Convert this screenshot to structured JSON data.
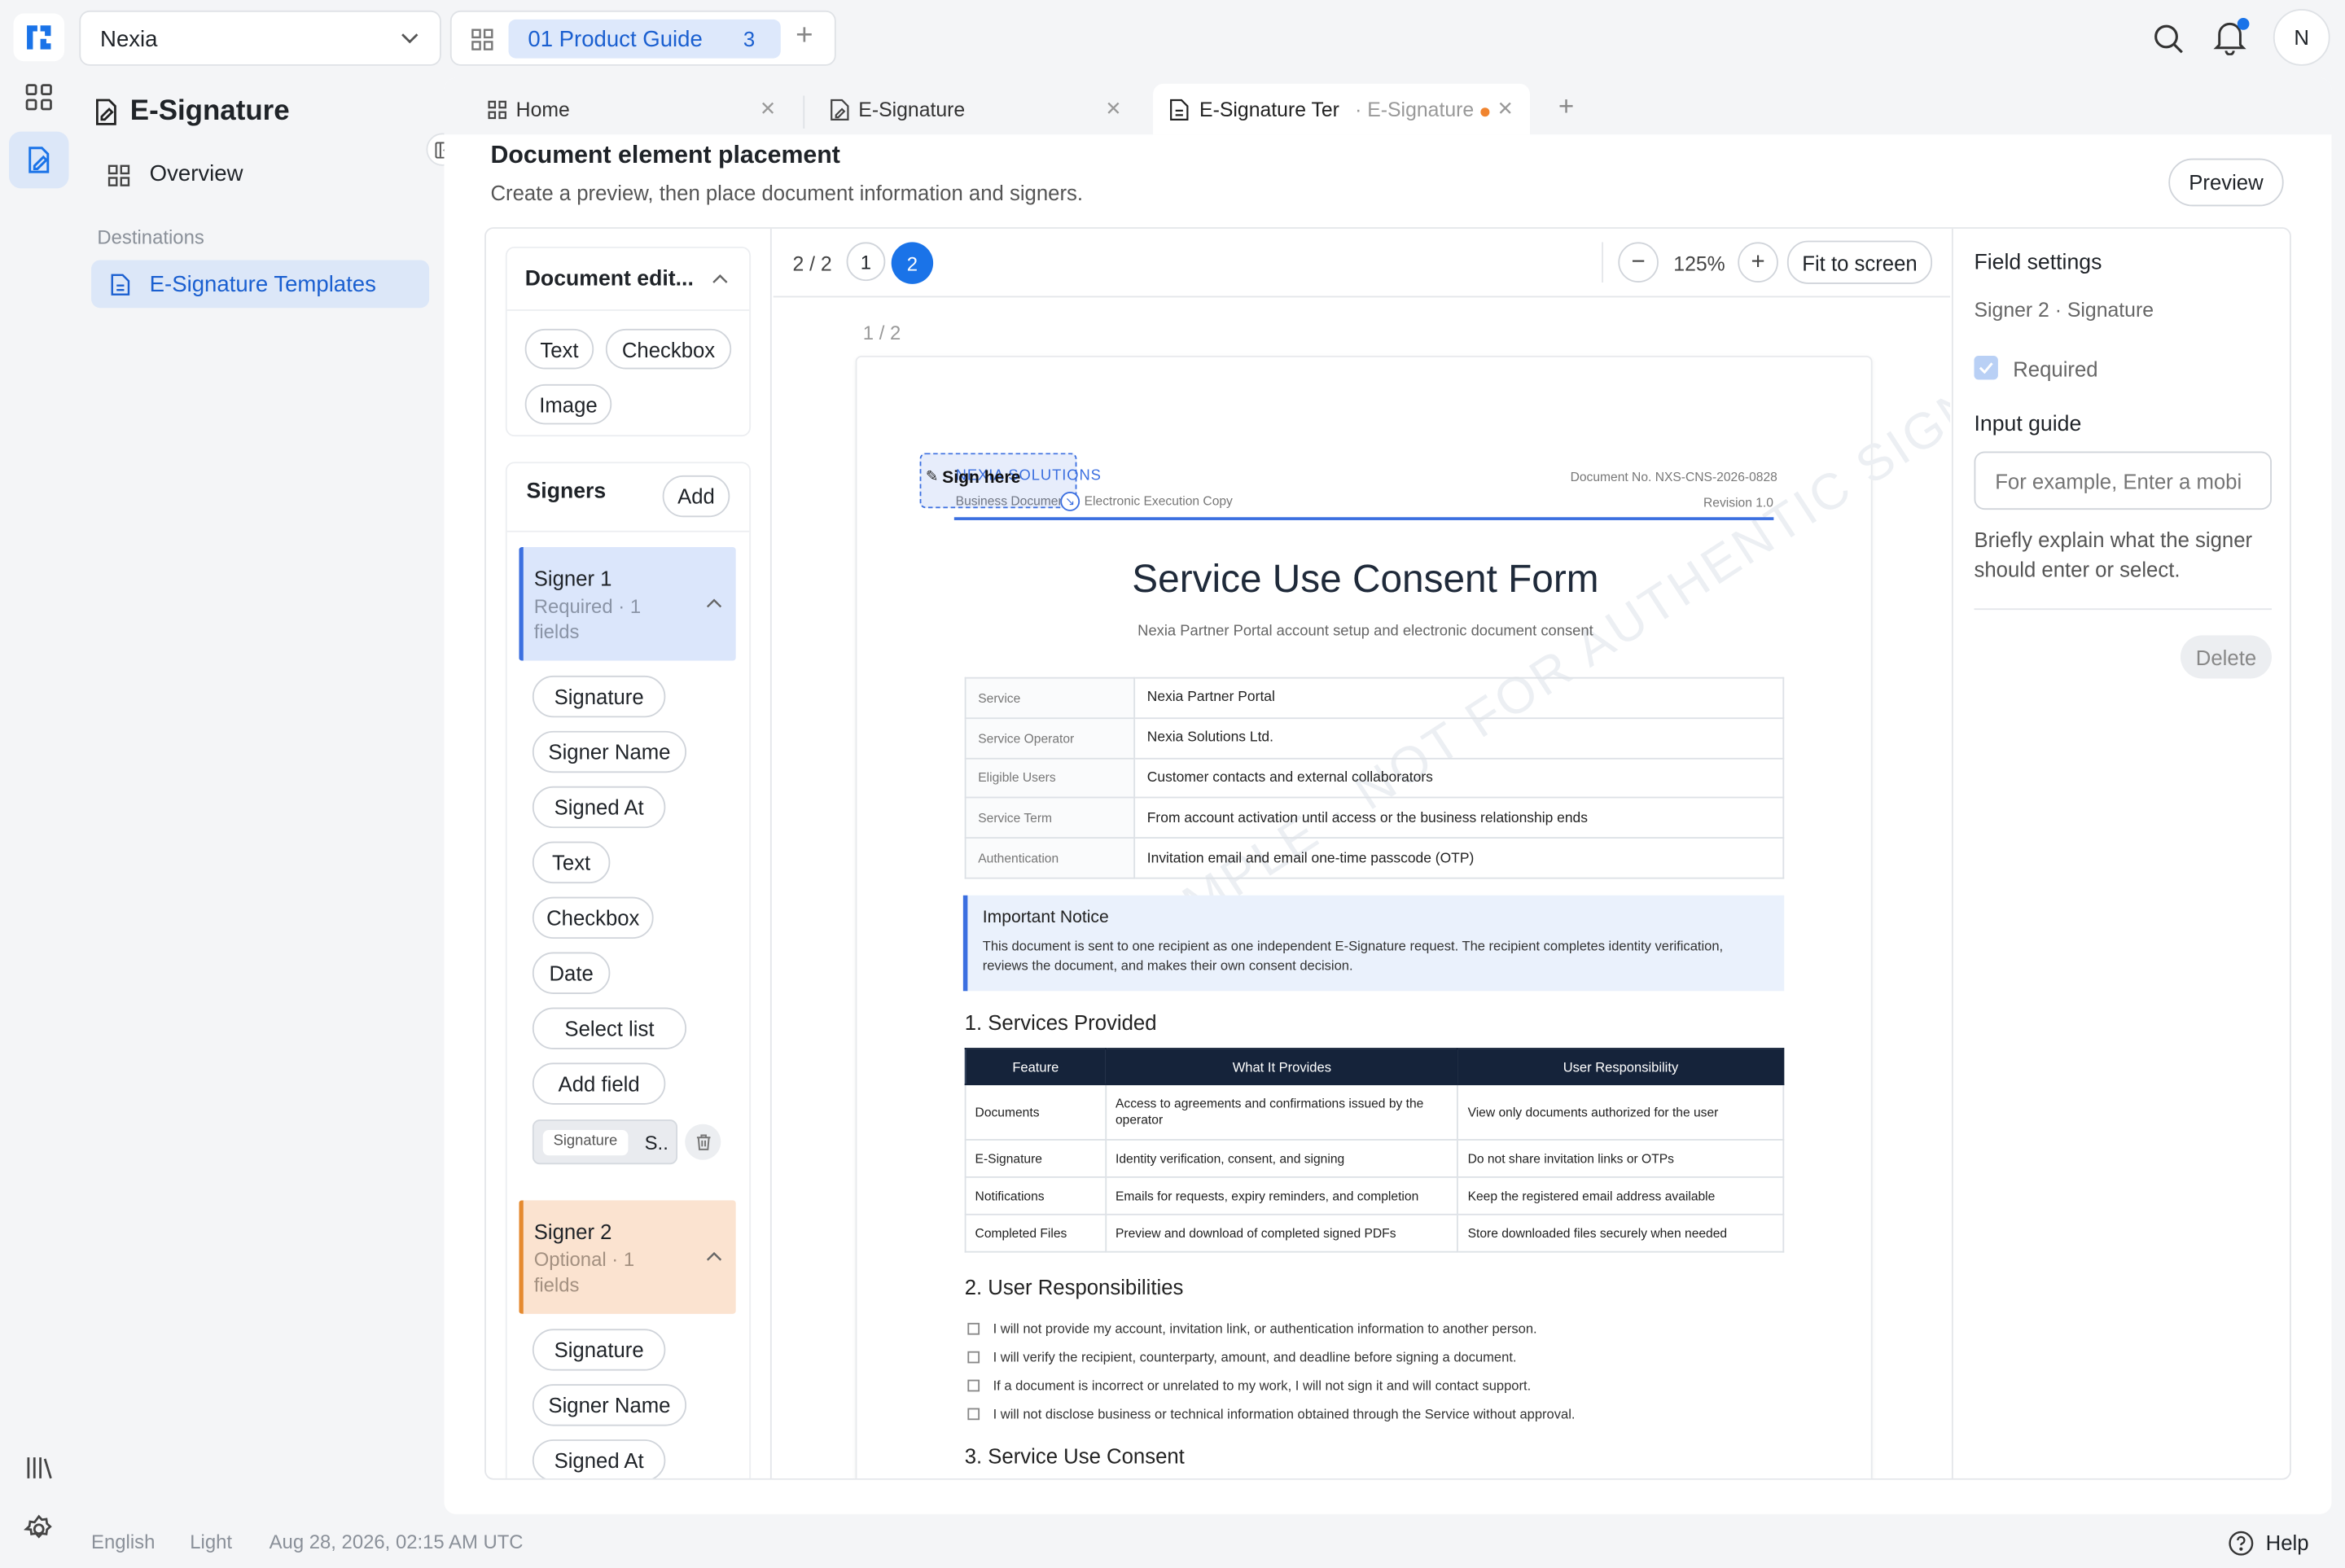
{
  "workspace": {
    "name": "Nexia"
  },
  "project_tab": {
    "label": "01 Product Guide",
    "count": "3"
  },
  "user": {
    "initial": "N"
  },
  "sidebar": {
    "title": "E-Signature",
    "overview": "Overview",
    "section": "Destinations",
    "active_item": "E-Signature Templates"
  },
  "footer": {
    "language": "English",
    "theme": "Light",
    "timestamp": "Aug 28, 2026, 02:15 AM UTC",
    "help": "Help"
  },
  "tabs": [
    {
      "label": "Home"
    },
    {
      "label": "E-Signature"
    },
    {
      "label": "E-Signature Ter",
      "sub": "· E-Signature"
    }
  ],
  "page": {
    "title": "Document element placement",
    "subtitle": "Create a preview, then place document information and signers.",
    "preview_button": "Preview"
  },
  "left_panel": {
    "doc_edit_title": "Document edit...",
    "doc_chips": [
      "Text",
      "Checkbox",
      "Image"
    ],
    "signers_title": "Signers",
    "add_button": "Add",
    "signer1": {
      "name": "Signer 1",
      "meta": "Required · 1 fields"
    },
    "signer1_fields": [
      "Signature",
      "Signer Name",
      "Signed At",
      "Text",
      "Checkbox",
      "Date",
      "Select list",
      "Add field"
    ],
    "placed_field": {
      "tag": "Signature",
      "text": "S.."
    },
    "signer2": {
      "name": "Signer 2",
      "meta": "Optional · 1 fields"
    },
    "signer2_fields": [
      "Signature",
      "Signer Name",
      "Signed At"
    ]
  },
  "toolbar": {
    "page_counter": "2 / 2",
    "pages": [
      "1",
      "2"
    ],
    "active_page": "2",
    "zoom": "125%",
    "fit_button": "Fit to screen",
    "page_label": "1 / 2"
  },
  "document": {
    "company": "NEXIA SOLUTIONS",
    "company_sub": "Business Document",
    "copy_label": "Electronic Execution Copy",
    "doc_no": "Document No. NXS-CNS-2026-0828",
    "revision": "Revision 1.0",
    "sign_here": "Sign here",
    "title": "Service Use Consent Form",
    "subtitle": "Nexia Partner Portal account setup and electronic document consent",
    "info_rows": [
      {
        "k": "Service",
        "v": "Nexia Partner Portal"
      },
      {
        "k": "Service Operator",
        "v": "Nexia Solutions Ltd."
      },
      {
        "k": "Eligible Users",
        "v": "Customer contacts and external collaborators"
      },
      {
        "k": "Service Term",
        "v": "From account activation until access or the business relationship ends"
      },
      {
        "k": "Authentication",
        "v": "Invitation email and email one-time passcode (OTP)"
      }
    ],
    "notice_title": "Important Notice",
    "notice_body": "This document is sent to one recipient as one independent E-Signature request. The recipient completes identity verification, reviews the document, and makes their own consent decision.",
    "watermark": "SAMPLE · NOT FOR AUTHENTIC SIGNATURE",
    "section1": "1. Services Provided",
    "services_head": [
      "Feature",
      "What It Provides",
      "User Responsibility"
    ],
    "services_rows": [
      [
        "Documents",
        "Access to agreements and confirmations issued by the operator",
        "View only documents authorized for the user"
      ],
      [
        "E-Signature",
        "Identity verification, consent, and signing",
        "Do not share invitation links or OTPs"
      ],
      [
        "Notifications",
        "Emails for requests, expiry reminders, and completion",
        "Keep the registered email address available"
      ],
      [
        "Completed Files",
        "Preview and download of completed signed PDFs",
        "Store downloaded files securely when needed"
      ]
    ],
    "section2": "2. User Responsibilities",
    "responsibilities": [
      "I will not provide my account, invitation link, or authentication information to another person.",
      "I will verify the recipient, counterparty, amount, and deadline before signing a document.",
      "If a document is incorrect or unrelated to my work, I will not sign it and will contact support.",
      "I will not disclose business or technical information obtained through the Service without approval."
    ],
    "section3": "3. Service Use Consent"
  },
  "field_settings": {
    "title": "Field settings",
    "context": "Signer 2 · Signature",
    "required_label": "Required",
    "input_guide_label": "Input guide",
    "input_placeholder": "For example, Enter a mobi",
    "help_text": "Briefly explain what the signer should enter or select.",
    "delete_button": "Delete"
  },
  "colors": {
    "accent": "#1a73e8",
    "signer1": "#3b6fe0",
    "signer2": "#e58a2f",
    "dark_header": "#15233a"
  }
}
